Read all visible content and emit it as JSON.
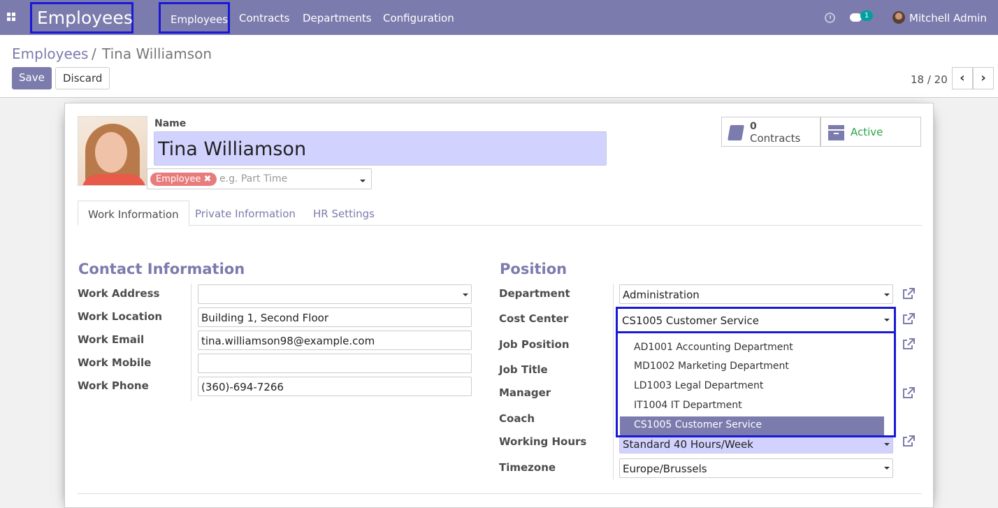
{
  "topbar": {
    "app_name": "Employees",
    "menu": [
      "Employees",
      "Contracts",
      "Departments",
      "Configuration"
    ],
    "chat_badge": "1",
    "user_name": "Mitchell Admin",
    "bg_color": "#7c7bad"
  },
  "control_panel": {
    "breadcrumb_parent": "Employees",
    "breadcrumb_sep": "/",
    "breadcrumb_current": "Tina Williamson",
    "save_label": "Save",
    "discard_label": "Discard",
    "pager": "18 / 20"
  },
  "form": {
    "name_label": "Name",
    "name_value": "Tina Williamson",
    "tag": "Employee",
    "tag_placeholder": "e.g. Part Time",
    "smart_buttons": {
      "contracts_count": "0",
      "contracts_label": "Contracts",
      "active_label": "Active"
    },
    "tabs": [
      "Work Information",
      "Private Information",
      "HR Settings"
    ],
    "active_tab": "Work Information",
    "contact": {
      "title": "Contact Information",
      "fields": [
        {
          "label": "Work Address",
          "value": ""
        },
        {
          "label": "Work Location",
          "value": "Building 1, Second Floor"
        },
        {
          "label": "Work Email",
          "value": "tina.williamson98@example.com"
        },
        {
          "label": "Work Mobile",
          "value": ""
        },
        {
          "label": "Work Phone",
          "value": "(360)-694-7266"
        }
      ]
    },
    "position": {
      "title": "Position",
      "fields": [
        {
          "label": "Department",
          "value": "Administration"
        },
        {
          "label": "Cost Center",
          "value": "CS1005 Customer Service"
        },
        {
          "label": "Job Position",
          "value": ""
        },
        {
          "label": "Job Title",
          "value": ""
        },
        {
          "label": "Manager",
          "value": ""
        },
        {
          "label": "Coach",
          "value": ""
        },
        {
          "label": "Working Hours",
          "value": "Standard 40 Hours/Week"
        },
        {
          "label": "Timezone",
          "value": "Europe/Brussels"
        }
      ]
    },
    "cost_center_options": [
      "AD1001 Accounting Department",
      "MD1002 Marketing Department",
      "LD1003 Legal Department",
      "IT1004 IT Department",
      "CS1005 Customer Service"
    ],
    "cost_center_selected": "CS1005 Customer Service"
  }
}
